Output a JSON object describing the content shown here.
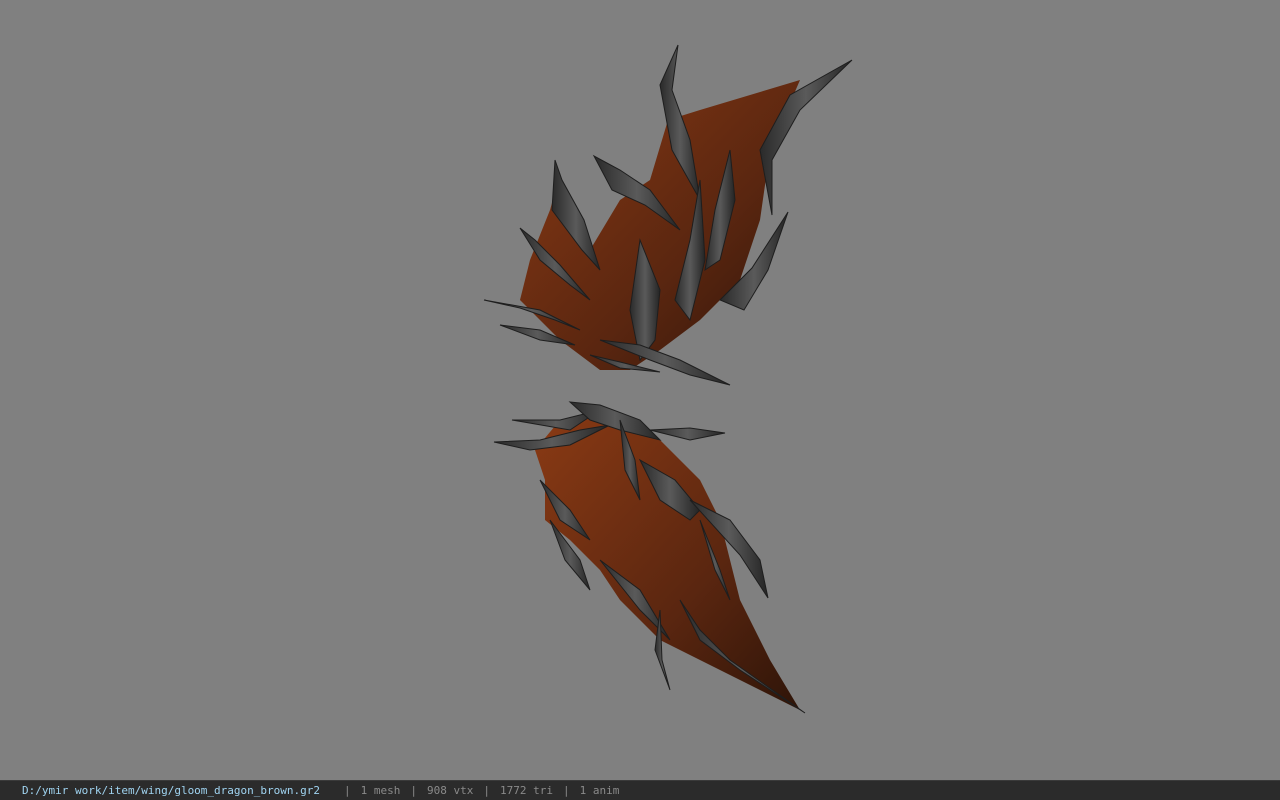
{
  "viewport": {
    "background": "#808080",
    "model": {
      "icon": "dragon-wing-model",
      "membrane_color": "#7a3212",
      "membrane_dark": "#3a1808",
      "bone_color": "#3a3a3a",
      "bone_highlight": "#6a6a6a"
    }
  },
  "status_bar": {
    "file_path": "D:/ymir work/item/wing/gloom_dragon_brown.gr2",
    "separator": "|",
    "mesh": "1 mesh",
    "vertices": "908 vtx",
    "triangles": "1772 tri",
    "animations": "1 anim",
    "path_color": "#9fd3f0",
    "text_color": "#8a8a8a",
    "background": "#2b2b2b"
  }
}
